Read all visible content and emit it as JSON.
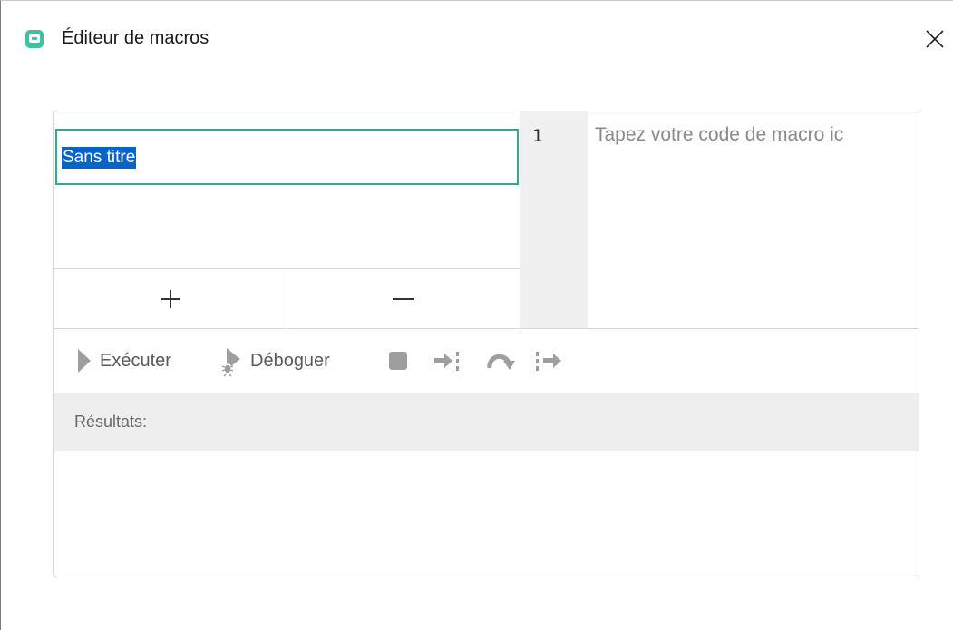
{
  "window": {
    "title": "Éditeur de macros",
    "icon": "macro-editor-app-icon",
    "close_icon": "close-icon"
  },
  "macro_list": {
    "items": [
      {
        "name": "Sans titre",
        "selected": true
      }
    ],
    "add_label": "+",
    "remove_label": "−"
  },
  "editor": {
    "line_numbers": [
      "1"
    ],
    "placeholder": "Tapez votre code de macro ic"
  },
  "toolbar": {
    "run_label": "Exécuter",
    "run_icon": "play-icon",
    "debug_label": "Déboguer",
    "debug_icon": "debug-icon",
    "stop_icon": "stop-icon",
    "step_in_icon": "step-into-icon",
    "step_over_icon": "step-over-icon",
    "step_out_icon": "step-out-icon"
  },
  "results": {
    "label": "Résultats:",
    "content": ""
  },
  "colors": {
    "accent": "#3aa58e",
    "selection": "#0a64c8",
    "icon_gray": "#9e9e9e",
    "gutter": "#f0f0f0",
    "results_header": "#eeeeee"
  }
}
